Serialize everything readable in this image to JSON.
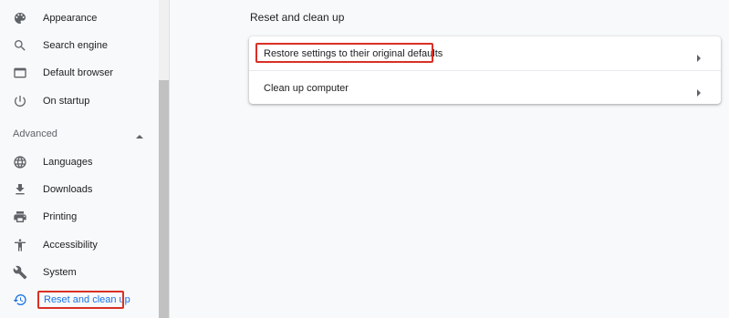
{
  "sidebar": {
    "items_top": [
      {
        "label": "Appearance",
        "icon": "palette-icon"
      },
      {
        "label": "Search engine",
        "icon": "search-icon"
      },
      {
        "label": "Default browser",
        "icon": "browser-icon"
      },
      {
        "label": "On startup",
        "icon": "power-icon"
      }
    ],
    "advanced_label": "Advanced",
    "items_advanced": [
      {
        "label": "Languages",
        "icon": "globe-icon"
      },
      {
        "label": "Downloads",
        "icon": "download-icon"
      },
      {
        "label": "Printing",
        "icon": "printer-icon"
      },
      {
        "label": "Accessibility",
        "icon": "accessibility-icon"
      },
      {
        "label": "System",
        "icon": "wrench-icon"
      },
      {
        "label": "Reset and clean up",
        "icon": "history-icon",
        "active": true
      }
    ]
  },
  "main": {
    "section_title": "Reset and clean up",
    "rows": [
      {
        "label": "Restore settings to their original defaults",
        "highlighted": true
      },
      {
        "label": "Clean up computer"
      }
    ]
  },
  "colors": {
    "accent": "#1a73e8",
    "highlight": "#d93025",
    "background": "#f8f9fa"
  }
}
